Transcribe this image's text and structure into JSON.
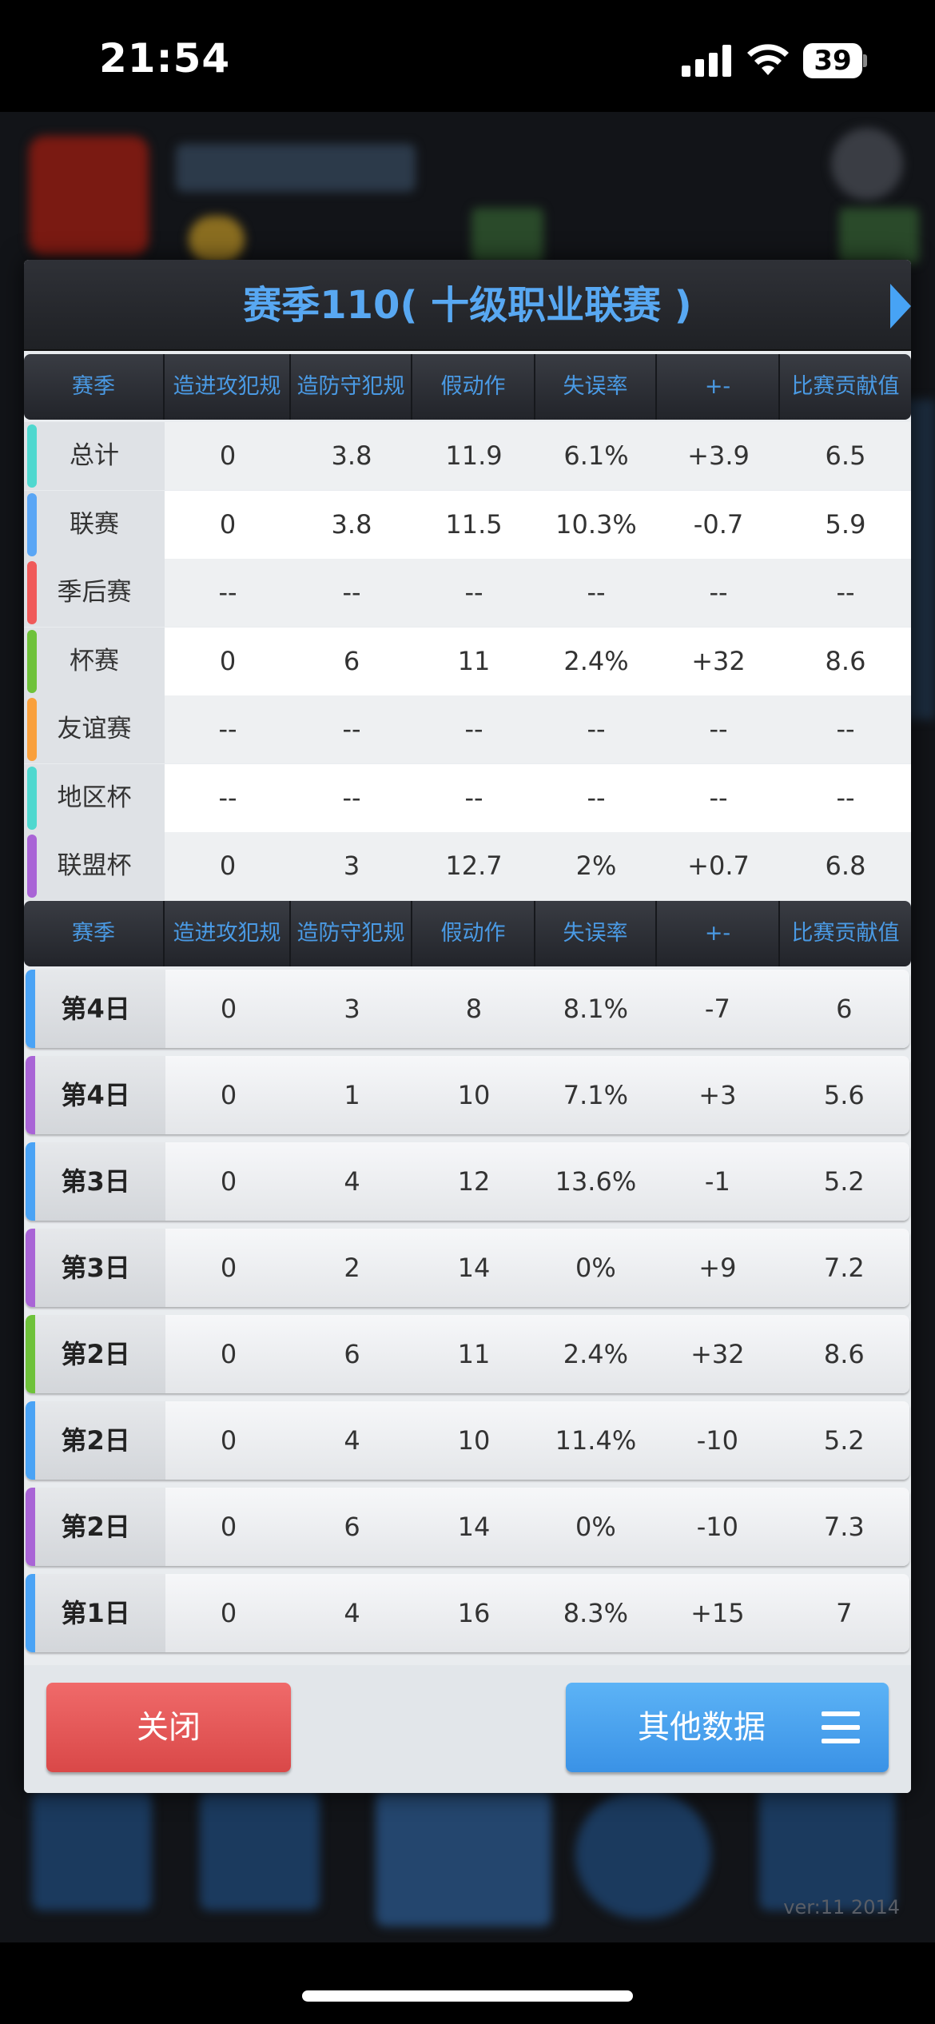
{
  "status_bar": {
    "time": "21:54",
    "battery": "39"
  },
  "modal": {
    "title": "赛季110( 十级职业联赛 )",
    "columns": [
      "赛季",
      "造进攻犯规",
      "造防守犯规",
      "假动作",
      "失误率",
      "+-",
      "比赛贡献值"
    ],
    "summary_rows": [
      {
        "label": "总计",
        "color": "#4fd8cf",
        "values": [
          "0",
          "3.8",
          "11.9",
          "6.1%",
          "+3.9",
          "6.5"
        ]
      },
      {
        "label": "联赛",
        "color": "#5aa6f5",
        "values": [
          "0",
          "3.8",
          "11.5",
          "10.3%",
          "-0.7",
          "5.9"
        ]
      },
      {
        "label": "季后赛",
        "color": "#f05a5a",
        "values": [
          "--",
          "--",
          "--",
          "--",
          "--",
          "--"
        ]
      },
      {
        "label": "杯赛",
        "color": "#6ec23a",
        "values": [
          "0",
          "6",
          "11",
          "2.4%",
          "+32",
          "8.6"
        ]
      },
      {
        "label": "友谊赛",
        "color": "#f9a03c",
        "values": [
          "--",
          "--",
          "--",
          "--",
          "--",
          "--"
        ]
      },
      {
        "label": "地区杯",
        "color": "#4fd8cf",
        "values": [
          "--",
          "--",
          "--",
          "--",
          "--",
          "--"
        ]
      },
      {
        "label": "联盟杯",
        "color": "#a964d6",
        "values": [
          "0",
          "3",
          "12.7",
          "2%",
          "+0.7",
          "6.8"
        ]
      }
    ],
    "game_rows": [
      {
        "label": "第4日",
        "color": "#4aa3f5",
        "values": [
          "0",
          "3",
          "8",
          "8.1%",
          "-7",
          "6"
        ]
      },
      {
        "label": "第4日",
        "color": "#a964d6",
        "values": [
          "0",
          "1",
          "10",
          "7.1%",
          "+3",
          "5.6"
        ]
      },
      {
        "label": "第3日",
        "color": "#4aa3f5",
        "values": [
          "0",
          "4",
          "12",
          "13.6%",
          "-1",
          "5.2"
        ]
      },
      {
        "label": "第3日",
        "color": "#a964d6",
        "values": [
          "0",
          "2",
          "14",
          "0%",
          "+9",
          "7.2"
        ]
      },
      {
        "label": "第2日",
        "color": "#6ec23a",
        "values": [
          "0",
          "6",
          "11",
          "2.4%",
          "+32",
          "8.6"
        ]
      },
      {
        "label": "第2日",
        "color": "#4aa3f5",
        "values": [
          "0",
          "4",
          "10",
          "11.4%",
          "-10",
          "5.2"
        ]
      },
      {
        "label": "第2日",
        "color": "#a964d6",
        "values": [
          "0",
          "6",
          "14",
          "0%",
          "-10",
          "7.3"
        ]
      },
      {
        "label": "第1日",
        "color": "#4aa3f5",
        "values": [
          "0",
          "4",
          "16",
          "8.3%",
          "+15",
          "7"
        ]
      }
    ],
    "close_label": "关闭",
    "other_label": "其他数据"
  },
  "background": {
    "version": "ver:11  2014"
  }
}
